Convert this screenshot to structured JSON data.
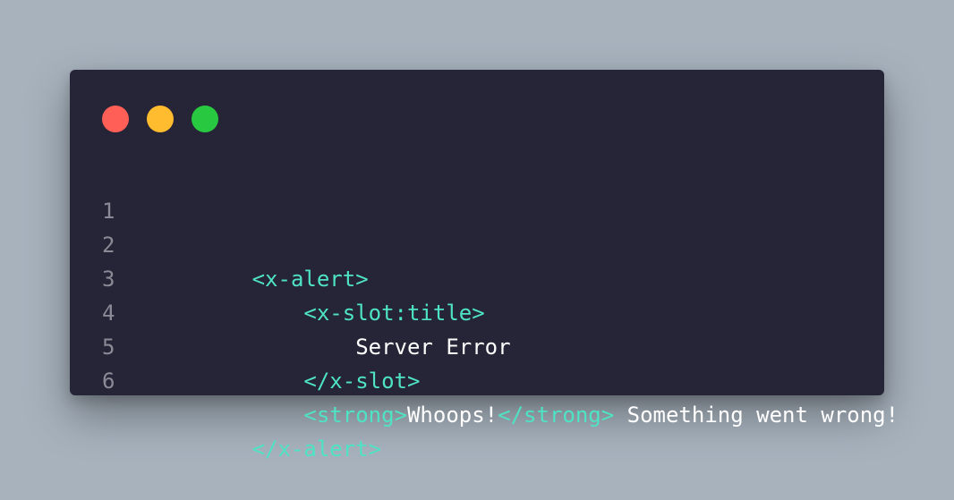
{
  "window": {
    "dots": [
      {
        "name": "close",
        "color": "#ff5f57"
      },
      {
        "name": "minimize",
        "color": "#febc2e"
      },
      {
        "name": "maximize",
        "color": "#28c840"
      }
    ]
  },
  "colors": {
    "tag": "#4ee3c4",
    "text": "#ffffff",
    "line_number": "#8b8a96",
    "background": "#262537"
  },
  "code": {
    "lines": [
      {
        "number": "1",
        "indent": "",
        "parts": [
          {
            "type": "tag",
            "text": "<x-alert>"
          }
        ]
      },
      {
        "number": "2",
        "indent": "    ",
        "parts": [
          {
            "type": "tag",
            "text": "<x-slot:title>"
          }
        ]
      },
      {
        "number": "3",
        "indent": "        ",
        "parts": [
          {
            "type": "txt",
            "text": "Server Error"
          }
        ]
      },
      {
        "number": "4",
        "indent": "    ",
        "parts": [
          {
            "type": "tag",
            "text": "</x-slot>"
          }
        ]
      },
      {
        "number": "5",
        "indent": "    ",
        "parts": [
          {
            "type": "tag",
            "text": "<strong>"
          },
          {
            "type": "txt",
            "text": "Whoops!"
          },
          {
            "type": "tag",
            "text": "</strong>"
          },
          {
            "type": "txt",
            "text": " Something went wrong!"
          }
        ]
      },
      {
        "number": "6",
        "indent": "",
        "parts": [
          {
            "type": "tag",
            "text": "</x-alert>"
          }
        ]
      }
    ]
  }
}
